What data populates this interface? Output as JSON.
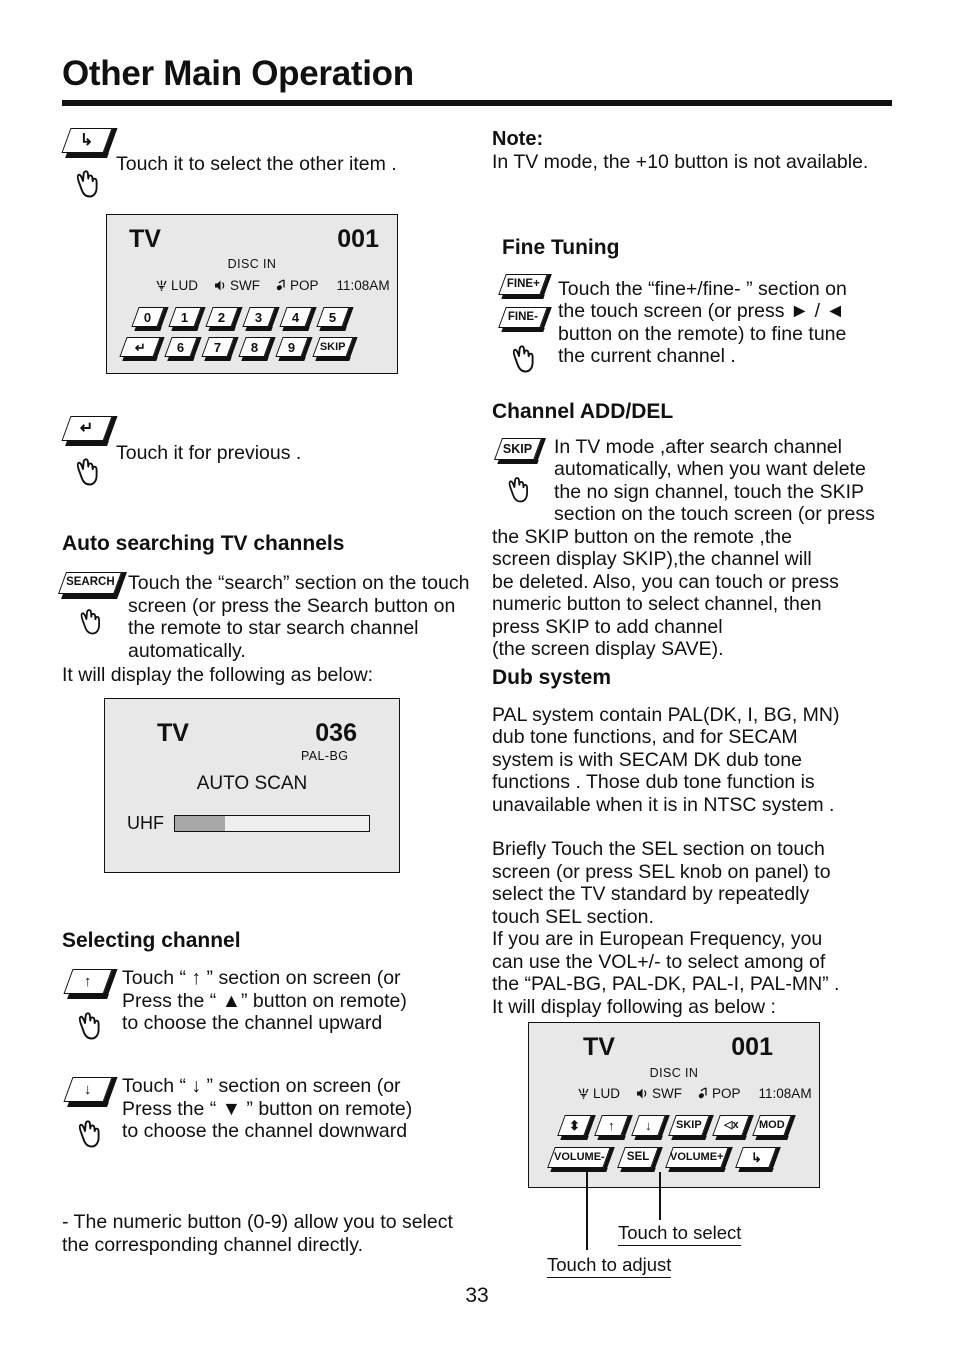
{
  "page": {
    "title": "Other Main Operation",
    "number": "33"
  },
  "left": {
    "other_item": {
      "key_label": "↳",
      "text": "Touch it to select the other item ."
    },
    "panel_keypad": {
      "mode": "TV",
      "channel": "001",
      "source": "DISC IN",
      "status": [
        {
          "icon": "antenna-icon",
          "label": "LUD"
        },
        {
          "icon": "speaker-icon",
          "label": "SWF"
        },
        {
          "icon": "music-note-icon",
          "label": "POP"
        }
      ],
      "time": "11:08AM",
      "keys_row1": [
        "0",
        "1",
        "2",
        "3",
        "4",
        "5"
      ],
      "keys_row2": [
        "↵",
        "6",
        "7",
        "8",
        "9",
        "SKIP"
      ]
    },
    "previous": {
      "key_label": "↵",
      "text": "Touch it for previous ."
    },
    "auto_search": {
      "heading": "Auto searching TV channels",
      "key_label": "SEARCH",
      "body": "Touch the  “search” section on the touch screen (or press the Search button on the remote to star search channel automatically.",
      "note": "It will display the following as below:"
    },
    "panel_scan": {
      "mode": "TV",
      "channel": "036",
      "standard": "PAL-BG",
      "status_text": "AUTO SCAN",
      "band": "UHF",
      "progress_percent": 26
    },
    "selecting": {
      "heading": "Selecting channel",
      "items": [
        {
          "key_label": "↑",
          "line1": "Touch “  ↑  ” section on screen (or",
          "line2": "Press the “ ▲” button on remote)",
          "line3": "to choose the channel upward"
        },
        {
          "key_label": "↓",
          "line1": "Touch “  ↓  ” section on screen (or",
          "line2": "Press the “  ▼  ” button on remote)",
          "line3": "to choose the channel downward"
        }
      ]
    },
    "numeric_note": "- The numeric button (0-9) allow you to select the corresponding channel directly."
  },
  "right": {
    "note": {
      "heading": "Note:",
      "text": "In TV mode, the +10 button is not available."
    },
    "fine_tuning": {
      "heading": "Fine Tuning",
      "key_labels": [
        "FINE+",
        "FINE-"
      ],
      "line1": "Touch the “fine+/fine- ” section on",
      "line2a": "the touch screen (or press ",
      "line2b": " ► / ◄",
      "line3": "button on the remote) to fine tune",
      "line4": "the current channel ."
    },
    "channel_add_del": {
      "heading": "Channel ADD/DEL",
      "key_label": "SKIP",
      "indent_lines": [
        "In TV mode ,after  search channel",
        "automatically, when you want delete",
        "the no sign channel, touch the SKIP",
        "section on the touch screen (or press"
      ],
      "full_lines": [
        "the SKIP button on the remote ,the",
        "screen display SKIP),the channel will",
        "be deleted. Also, you can touch or press",
        "numeric button to select channel, then",
        "press SKIP to add channel",
        "(the screen display SAVE)."
      ]
    },
    "dub_system": {
      "heading": "Dub system",
      "paragraph1": [
        "PAL system contain PAL(DK, I, BG, MN)",
        "dub tone functions, and for SECAM",
        "system is with SECAM DK dub tone",
        "functions . Those dub tone function is",
        "unavailable when it is in NTSC system ."
      ],
      "paragraph2": [
        "Briefly Touch the SEL section on touch",
        "screen (or press SEL knob on panel) to",
        "select the TV standard by repeatedly",
        "touch SEL section.",
        "If you are in European Frequency, you",
        "can use the VOL+/- to select among of",
        "the “PAL-BG, PAL-DK, PAL-I, PAL-MN” .",
        "It will display following as below :"
      ]
    },
    "panel_controls": {
      "mode": "TV",
      "channel": "001",
      "source": "DISC IN",
      "status": [
        {
          "icon": "antenna-icon",
          "label": "LUD"
        },
        {
          "icon": "speaker-icon",
          "label": "SWF"
        },
        {
          "icon": "music-note-icon",
          "label": "POP"
        }
      ],
      "time": "11:08AM",
      "keys_row1": [
        "⬍",
        "↑",
        "↓",
        "SKIP",
        "◁x",
        "MOD"
      ],
      "keys_row2": [
        "VOLUME-",
        "SEL",
        "VOLUME+",
        "↳"
      ]
    },
    "callouts": {
      "select": "Touch to select",
      "adjust": "Touch to adjust"
    }
  },
  "colors": {
    "ink": "#111111",
    "panel_bg": "#e8e8e8",
    "progress_fill": "#a8a8a8",
    "progress_track": "#efefef"
  }
}
